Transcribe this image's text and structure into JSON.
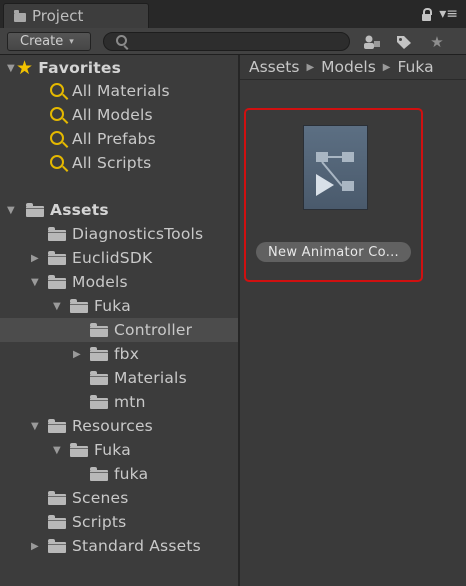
{
  "window": {
    "tab_title": "Project",
    "menu_glyph": "▾≡"
  },
  "toolbar": {
    "create_label": "Create",
    "create_arrow": "▾",
    "search_placeholder": "",
    "buttons": [
      {
        "name": "filter-by-type-icon",
        "glyph": "⚗"
      },
      {
        "name": "filter-by-label-icon",
        "glyph": "⬟"
      },
      {
        "name": "favorite-star-icon",
        "glyph": "★"
      }
    ]
  },
  "tree": {
    "favorites": {
      "label": "Favorites",
      "items": [
        "All Materials",
        "All Models",
        "All Prefabs",
        "All Scripts"
      ]
    },
    "assets": {
      "label": "Assets",
      "items": [
        {
          "label": "DiagnosticsTools",
          "expander": ""
        },
        {
          "label": "EuclidSDK",
          "expander": "▶"
        },
        {
          "label": "Models",
          "expander": "▼"
        },
        {
          "label": "Fuka",
          "expander": "▼"
        },
        {
          "label": "Controller",
          "expander": "",
          "selected": true
        },
        {
          "label": "fbx",
          "expander": "▶"
        },
        {
          "label": "Materials",
          "expander": ""
        },
        {
          "label": "mtn",
          "expander": ""
        },
        {
          "label": "Resources",
          "expander": "▼"
        },
        {
          "label": "Fuka",
          "expander": "▼"
        },
        {
          "label": "fuka",
          "expander": ""
        },
        {
          "label": "Scenes",
          "expander": ""
        },
        {
          "label": "Scripts",
          "expander": ""
        },
        {
          "label": "Standard Assets",
          "expander": "▶"
        }
      ]
    }
  },
  "breadcrumb": {
    "items": [
      "Assets",
      "Models",
      "Fuka"
    ],
    "separator": "▶"
  },
  "assets_panel": {
    "items": [
      {
        "label": "New Animator Co...",
        "icon": "animator-controller-icon"
      }
    ]
  },
  "colors": {
    "selection_outline": "#d01010",
    "favorite_star": "#f2c200",
    "search_icon": "#e4b800"
  }
}
